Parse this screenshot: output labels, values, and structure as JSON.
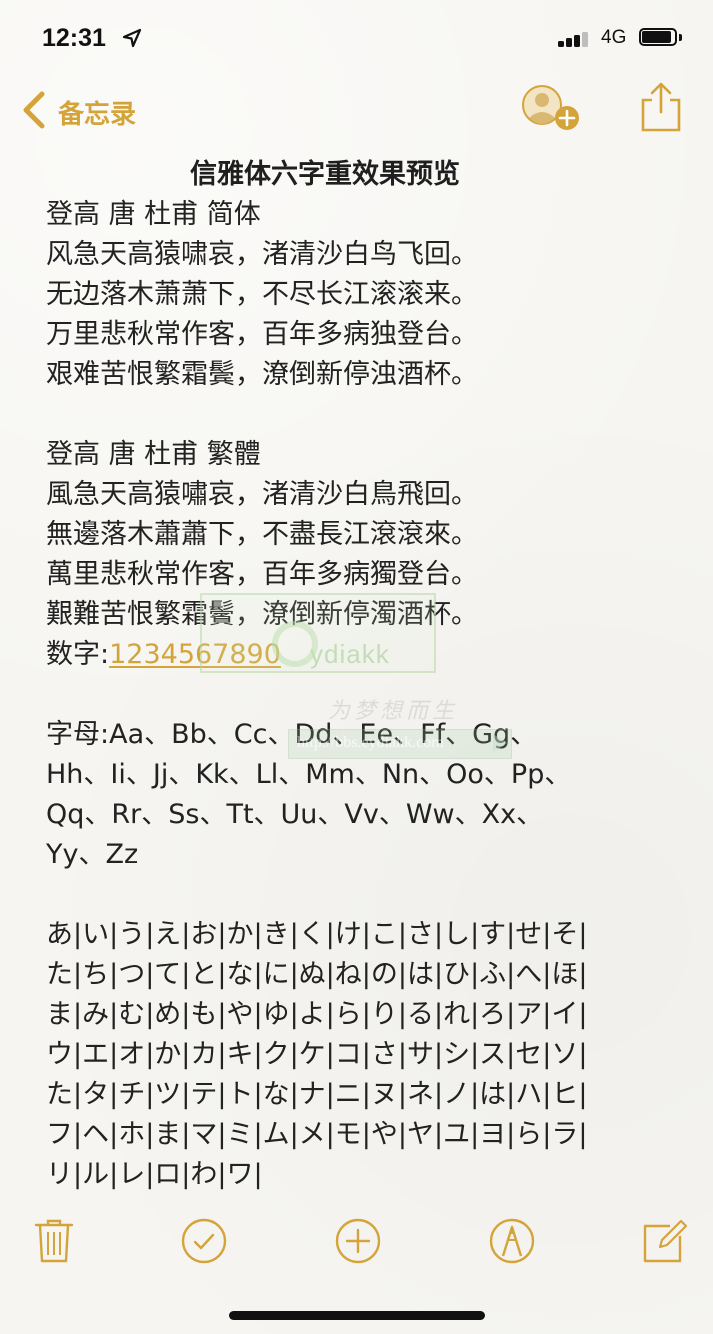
{
  "status_bar": {
    "time": "12:31",
    "network": "4G",
    "signal_bars_filled": 3,
    "signal_bars_total": 4,
    "battery_level": 0.9
  },
  "nav": {
    "back_label": "备忘录",
    "accent_color": "#d4a43a"
  },
  "note": {
    "title": "信雅体六字重效果预览",
    "lines": [
      "登高 唐 杜甫 简体",
      "风急天高猿啸哀，渚清沙白鸟飞回。",
      "无边落木萧萧下，不尽长江滚滚来。",
      "万里悲秋常作客，百年多病独登台。",
      "艰难苦恨繁霜鬓，潦倒新停浊酒杯。",
      "",
      "登高 唐 杜甫 繁體",
      "風急天高猿嘯哀，渚清沙白鳥飛回。",
      "無邊落木蕭蕭下，不盡長江滾滾來。",
      "萬里悲秋常作客，百年多病獨登台。",
      "艱難苦恨繁霜鬢，潦倒新停濁酒杯。"
    ],
    "digits_label": "数字:",
    "digits_value": "1234567890",
    "after_digits": [
      "",
      "字母:Aa、Bb、Cc、Dd、Ee、Ff、Gg、",
      "Hh、Ii、Jj、Kk、Ll、Mm、Nn、Oo、Pp、",
      "Qq、Rr、Ss、Tt、Uu、Vv、Ww、Xx、",
      "Yy、Zz",
      "",
      "あ|い|う|え|お|か|き|く|け|こ|さ|し|す|せ|そ|",
      "た|ち|つ|て|と|な|に|ぬ|ね|の|は|ひ|ふ|へ|ほ|",
      "ま|み|む|め|も|や|ゆ|よ|ら|り|る|れ|ろ|ア|イ|",
      "ウ|エ|オ|か|カ|キ|ク|ケ|コ|さ|サ|シ|ス|セ|ソ|",
      "た|タ|チ|ツ|テ|ト|な|ナ|ニ|ヌ|ネ|ノ|は|ハ|ヒ|",
      "フ|ヘ|ホ|ま|マ|ミ|ム|メ|モ|や|ヤ|ユ|ヨ|ら|ラ|",
      "リ|ル|レ|ロ|わ|ワ|"
    ]
  },
  "watermark": {
    "logo_text": "ydiakk",
    "slogan": "为梦想而生",
    "url": "http://bbs.eydiakk.com"
  },
  "toolbar": {
    "icons": [
      "trash-icon",
      "checklist-icon",
      "add-icon",
      "markup-icon",
      "compose-icon"
    ]
  }
}
